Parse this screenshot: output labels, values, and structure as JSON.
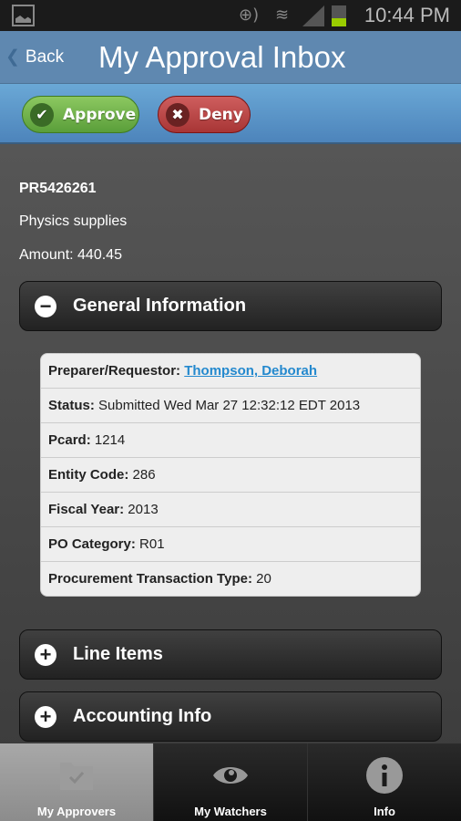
{
  "status_bar": {
    "time": "10:44 PM",
    "battery_color": "#99cc00"
  },
  "header": {
    "back_label": "Back",
    "title": "My Approval Inbox"
  },
  "toolbar": {
    "approve_label": "Approve",
    "deny_label": "Deny"
  },
  "request": {
    "id": "PR5426261",
    "description": "Physics supplies",
    "amount": "Amount: 440.45"
  },
  "sections": {
    "general": {
      "label": "General Information",
      "expanded": true,
      "rows": [
        {
          "label": "Preparer/Requestor:",
          "value": "Thompson, Deborah",
          "link": true
        },
        {
          "label": "Status:",
          "value": "Submitted Wed Mar 27 12:32:12 EDT 2013"
        },
        {
          "label": "Pcard:",
          "value": "1214"
        },
        {
          "label": "Entity Code:",
          "value": "286"
        },
        {
          "label": "Fiscal Year:",
          "value": "2013"
        },
        {
          "label": "PO Category:",
          "value": "R01"
        },
        {
          "label": "Procurement Transaction Type:",
          "value": "20"
        }
      ]
    },
    "line_items": {
      "label": "Line Items",
      "expanded": false
    },
    "accounting": {
      "label": "Accounting Info",
      "expanded": false
    }
  },
  "tabs": [
    {
      "label": "My Approvers",
      "icon": "folder-check-icon",
      "active": true
    },
    {
      "label": "My Watchers",
      "icon": "eye-icon",
      "active": false
    },
    {
      "label": "Info",
      "icon": "info-icon",
      "active": false
    }
  ]
}
